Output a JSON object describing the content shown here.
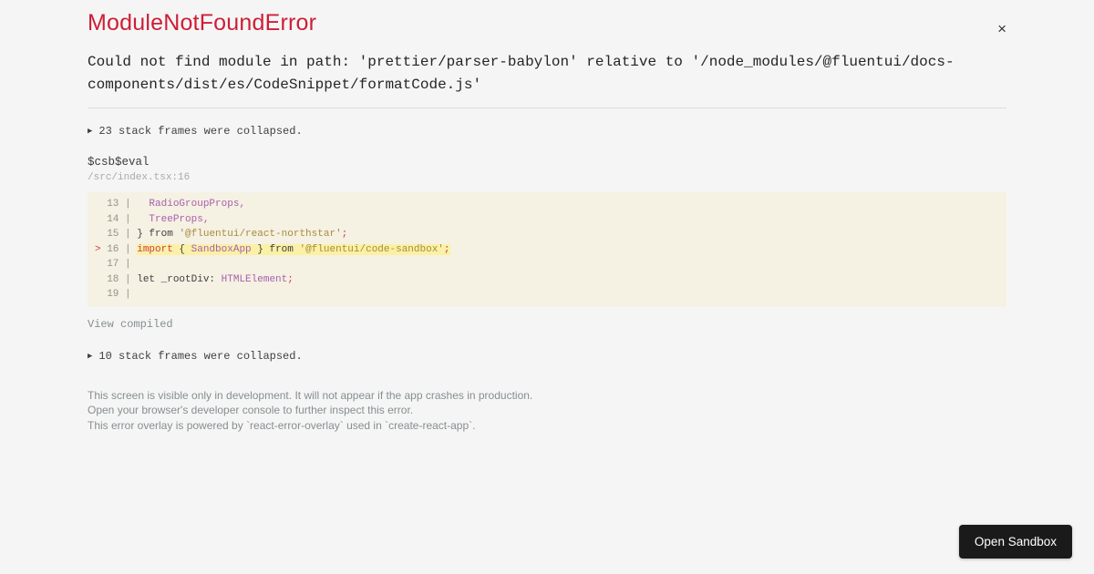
{
  "colors": {
    "page_bg": "#f5f5f5",
    "title_red": "#ce1e36",
    "text_dark": "#252525",
    "divider": "#dedede",
    "trace_text": "#404040",
    "frame_fn": "#3b3b3b",
    "frame_loc": "#a9a9a9",
    "muted_gray": "#878e91",
    "close_gray": "#333333",
    "code_bg": "#f5f1e3",
    "highlight_bg": "#faf1a6",
    "tok_plain": "#403f3f",
    "tok_purple": "#a85fad",
    "tok_red": "#cd3c46",
    "tok_olive": "#a98c3c",
    "lineno_gray": "#93938a",
    "button_bg": "#1a1a1a",
    "button_text": "#ffffff"
  },
  "header": {
    "title": "ModuleNotFoundError",
    "close_icon": "×"
  },
  "message": "Could not find module in path: 'prettier/parser-babylon' relative to '/node_modules/@fluentui/docs-components/dist/es/CodeSnippet/formatCode.js'",
  "trace": {
    "collapsed_top": {
      "arrow": "▶",
      "label": "23 stack frames were collapsed."
    },
    "frame": {
      "function": "$csb$eval",
      "location": "/src/index.tsx:16"
    },
    "code": {
      "lines": [
        {
          "marker": " ",
          "num": "13",
          "highlight": false,
          "tokens": [
            {
              "t": "  ",
              "c": "plain"
            },
            {
              "t": "RadioGroupProps,",
              "c": "purple"
            }
          ]
        },
        {
          "marker": " ",
          "num": "14",
          "highlight": false,
          "tokens": [
            {
              "t": "  ",
              "c": "plain"
            },
            {
              "t": "TreeProps,",
              "c": "purple"
            }
          ]
        },
        {
          "marker": " ",
          "num": "15",
          "highlight": false,
          "tokens": [
            {
              "t": "} from ",
              "c": "plain"
            },
            {
              "t": "'@fluentui/react-northstar'",
              "c": "olive"
            },
            {
              "t": ";",
              "c": "red"
            }
          ]
        },
        {
          "marker": ">",
          "num": "16",
          "highlight": true,
          "tokens": [
            {
              "t": "import",
              "c": "red"
            },
            {
              "t": " { ",
              "c": "plain"
            },
            {
              "t": "SandboxApp",
              "c": "purple"
            },
            {
              "t": " } ",
              "c": "plain"
            },
            {
              "t": "from ",
              "c": "plain"
            },
            {
              "t": "'@fluentui/code-sandbox'",
              "c": "olive"
            },
            {
              "t": ";",
              "c": "red"
            }
          ]
        },
        {
          "marker": " ",
          "num": "17",
          "highlight": false,
          "tokens": []
        },
        {
          "marker": " ",
          "num": "18",
          "highlight": false,
          "tokens": [
            {
              "t": "let _rootDiv: ",
              "c": "plain"
            },
            {
              "t": "HTMLElement",
              "c": "purple"
            },
            {
              "t": ";",
              "c": "red"
            }
          ]
        },
        {
          "marker": " ",
          "num": "19",
          "highlight": false,
          "tokens": []
        }
      ]
    },
    "view_compiled_label": "View compiled",
    "collapsed_bottom": {
      "arrow": "▶",
      "label": "10 stack frames were collapsed."
    }
  },
  "footer": {
    "lines": [
      "This screen is visible only in development. It will not appear if the app crashes in production.",
      "Open your browser's developer console to further inspect this error.",
      "This error overlay is powered by `react-error-overlay` used in `create-react-app`."
    ]
  },
  "open_sandbox": {
    "label": "Open Sandbox"
  }
}
